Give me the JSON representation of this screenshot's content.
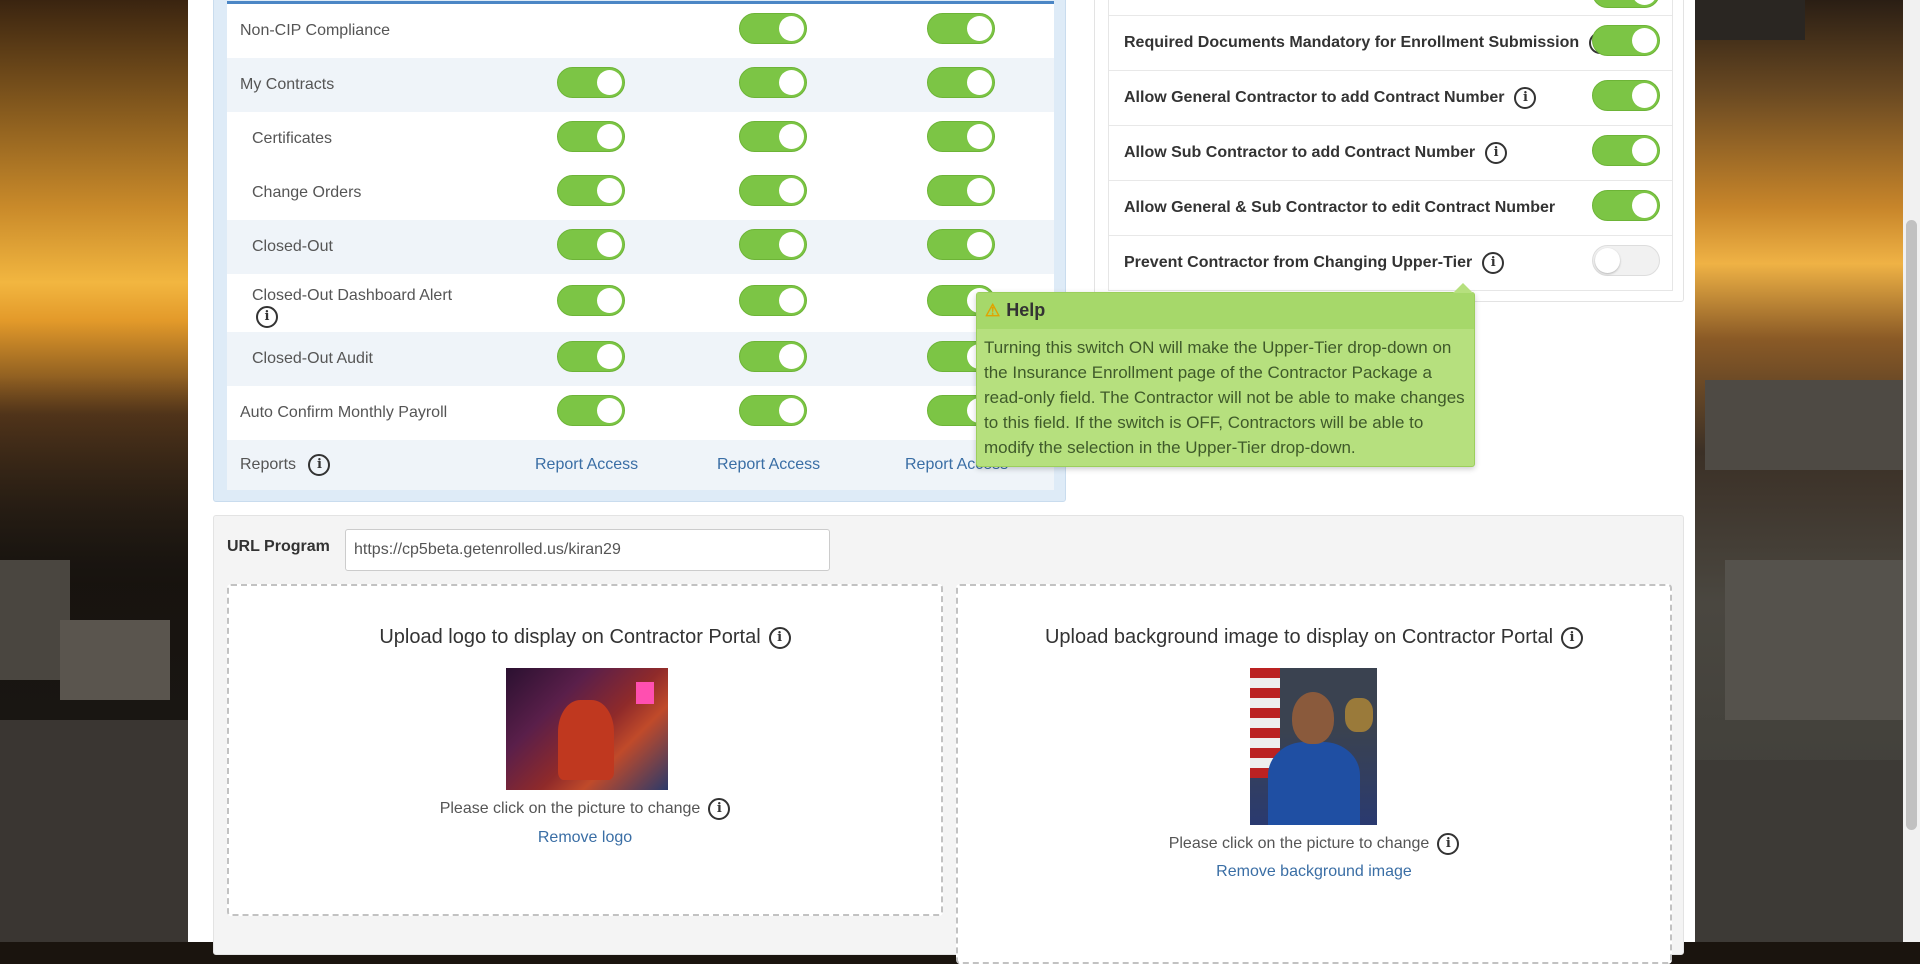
{
  "permissions": {
    "rows": [
      {
        "label": "Non-CIP Compliance",
        "toggles": [
          false,
          true,
          true
        ],
        "show": [
          false,
          true,
          true
        ]
      },
      {
        "label": "My Contracts",
        "toggles": [
          true,
          true,
          true
        ],
        "show": [
          true,
          true,
          true
        ]
      },
      {
        "label": "Certificates",
        "toggles": [
          true,
          true,
          true
        ],
        "show": [
          true,
          true,
          true
        ]
      },
      {
        "label": "Change Orders",
        "toggles": [
          true,
          true,
          true
        ],
        "show": [
          true,
          true,
          true
        ]
      },
      {
        "label": "Closed-Out",
        "toggles": [
          true,
          true,
          true
        ],
        "show": [
          true,
          true,
          true
        ]
      },
      {
        "label": "Closed-Out Dashboard Alert",
        "toggles": [
          true,
          true,
          true
        ],
        "show": [
          true,
          true,
          true
        ]
      },
      {
        "label": "Closed-Out Audit",
        "toggles": [
          true,
          true,
          true
        ],
        "show": [
          true,
          true,
          true
        ]
      },
      {
        "label": "Auto Confirm Monthly Payroll",
        "toggles": [
          true,
          true,
          true
        ],
        "show": [
          true,
          true,
          true
        ]
      }
    ],
    "reports_label": "Reports",
    "report_access_links": [
      "Report Access",
      "Report Access",
      "Report Access"
    ]
  },
  "settings": {
    "rows": [
      {
        "label": "Required Documents Mandatory for Enrollment Submission",
        "on": true
      },
      {
        "label": "Allow General Contractor to add Contract Number",
        "on": true
      },
      {
        "label": "Allow Sub Contractor to add Contract Number",
        "on": true
      },
      {
        "label": "Allow General & Sub Contractor to edit Contract Number",
        "on": true
      },
      {
        "label": "Prevent Contractor from Changing Upper-Tier",
        "on": false
      }
    ]
  },
  "tooltip": {
    "title": "Help",
    "body": "Turning this switch ON will make the Upper-Tier drop-down on the Insurance Enrollment page of the Contractor Package a read-only field. The Contractor will not be able to make changes to this field. If the switch is OFF, Contractors will be able to modify the selection in the Upper-Tier drop-down."
  },
  "url_program": {
    "label": "URL Program",
    "value": "https://cp5beta.getenrolled.us/kiran29"
  },
  "upload_logo": {
    "title": "Upload logo to display on Contractor Portal",
    "hint": "Please click on the picture to change",
    "remove": "Remove logo"
  },
  "upload_background": {
    "title": "Upload background image to display on Contractor Portal",
    "hint": "Please click on the picture to change",
    "remove": "Remove background image"
  },
  "colors": {
    "toggle_on": "#7cc545",
    "header_accent": "#4b86c5",
    "tooltip_bg": "#b6e07e",
    "link": "#3a6ea5"
  },
  "icons": {
    "info": "info-circle-icon",
    "warning": "warning-triangle-icon"
  }
}
